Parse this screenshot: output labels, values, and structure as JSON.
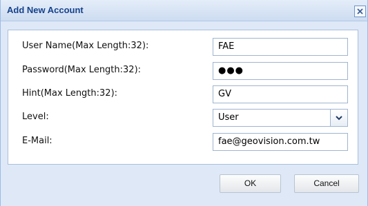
{
  "dialog": {
    "title": "Add New Account",
    "close_icon": "close-icon"
  },
  "form": {
    "username": {
      "label": "User Name(Max Length:32):",
      "value": "FAE"
    },
    "password": {
      "label": "Password(Max Length:32):",
      "value": "●●●"
    },
    "hint": {
      "label": "Hint(Max Length:32):",
      "value": "GV"
    },
    "level": {
      "label": "Level:",
      "value": "User"
    },
    "email": {
      "label": "E-Mail:",
      "value": "fae@geovision.com.tw"
    }
  },
  "buttons": {
    "ok": "OK",
    "cancel": "Cancel"
  }
}
